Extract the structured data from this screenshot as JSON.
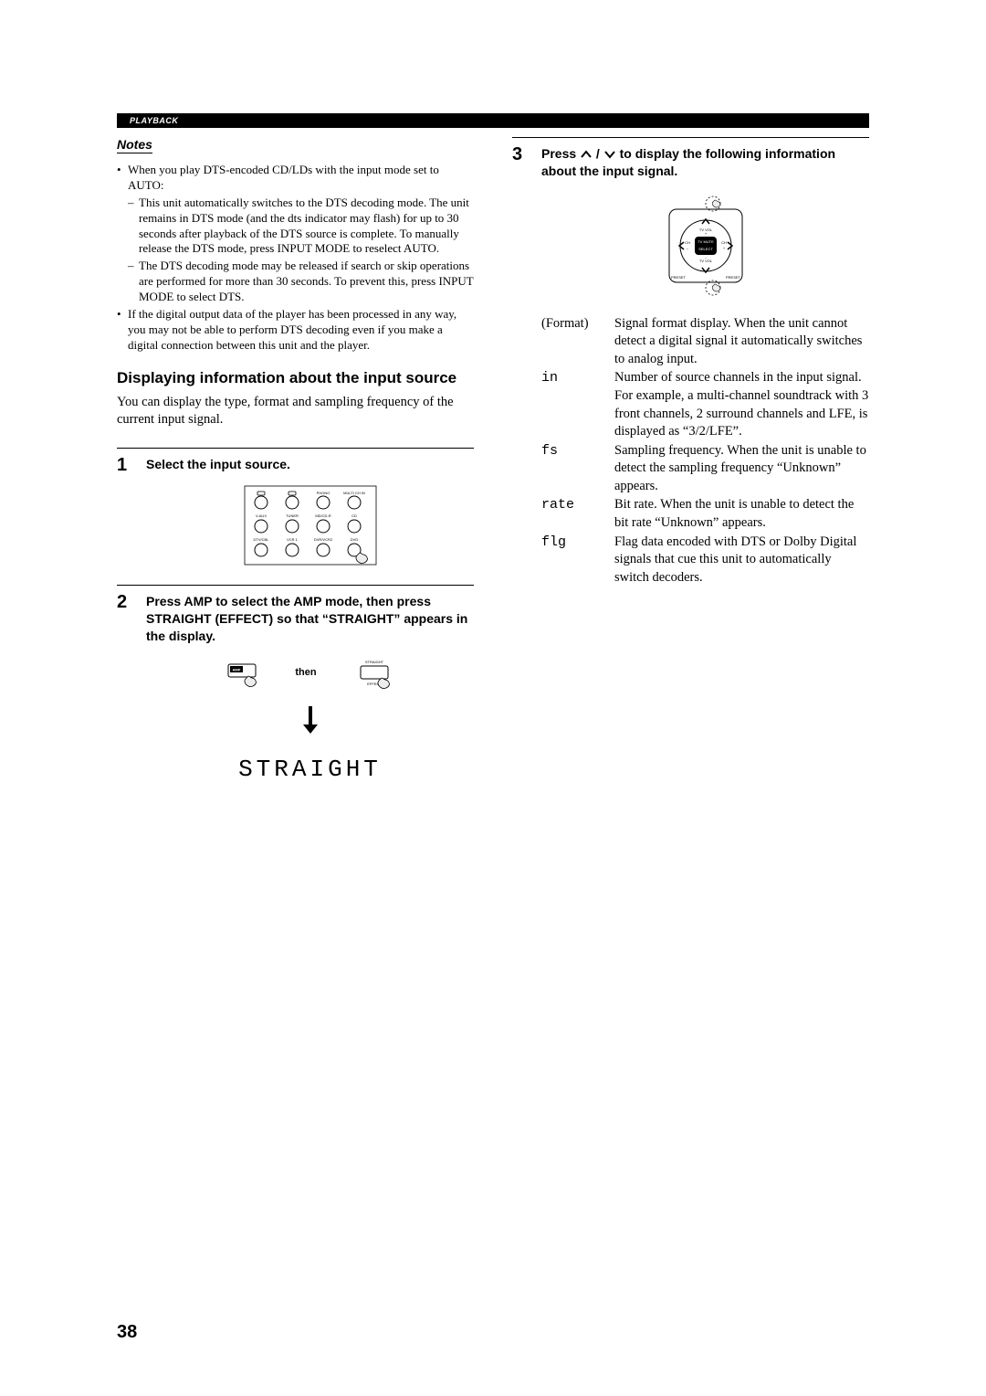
{
  "section": "PLAYBACK",
  "notesHeading": "Notes",
  "notes": {
    "item1": "When you play DTS-encoded CD/LDs with the input mode set to AUTO:",
    "sub1": "This unit automatically switches to the DTS decoding mode. The unit remains in DTS mode (and the dts indicator may flash) for up to 30 seconds after playback of the DTS source is complete. To manually release the DTS mode, press INPUT MODE to reselect AUTO.",
    "sub2": "The DTS decoding mode may be released if search or skip operations are performed for more than 30 seconds. To prevent this, press INPUT MODE to select DTS.",
    "item2": "If the digital output data of the player has been processed in any way, you may not be able to perform DTS decoding even if you make a digital connection between this unit and the player."
  },
  "heading": "Displaying information about the input source",
  "body": "You can display the type, format and sampling frequency of the current input signal.",
  "step1": {
    "num": "1",
    "text": "Select the input source.",
    "labels": {
      "r1c3": "PHONO",
      "r1c4": "MULTI CH IN",
      "r2c1": "V-AUX",
      "r2c2": "TUNER",
      "r2c3": "MD/CD-R",
      "r2c4": "CD",
      "r3c1": "DTV/CBL",
      "r3c2": "VCR 1",
      "r3c3": "DVR/VCR2",
      "r3c4": "DVD"
    }
  },
  "step2": {
    "num": "2",
    "text": "Press AMP to select the AMP mode, then press STRAIGHT (EFFECT) so that “STRAIGHT” appears in the display.",
    "labels": {
      "amp": "AMP",
      "then": "then",
      "straight": "STRAIGHT",
      "effect": "EFFECT"
    },
    "display": "STRAIGHT"
  },
  "step3": {
    "num": "3",
    "textPrefix": "Press ",
    "textSuffix": " to display the following information about the input signal.",
    "labels": {
      "tvvolplus": "TV VOL",
      "tvvolminus": "TV VOL",
      "chminus": "CH",
      "chplus": "CH",
      "minus": "–",
      "plus": "+",
      "tvmute": "TV MUTE",
      "select": "SELECT",
      "presetL": "PRESET",
      "presetR": "PRESET"
    }
  },
  "definitions": {
    "format": {
      "term": "(Format)",
      "def": "Signal format display. When the unit cannot detect a digital signal it automatically switches to analog input."
    },
    "in": {
      "term": "in",
      "def": "Number of source channels in the input signal. For example, a multi-channel soundtrack with 3 front channels, 2 surround channels and LFE, is displayed as “3/2/LFE”."
    },
    "fs": {
      "term": "fs",
      "def": "Sampling frequency. When the unit is unable to detect the sampling frequency “Unknown” appears."
    },
    "rate": {
      "term": "rate",
      "def": "Bit rate. When the unit is unable to detect the bit rate “Unknown” appears."
    },
    "flg": {
      "term": "flg",
      "def": "Flag data encoded with DTS or Dolby Digital signals that cue this unit to automatically switch decoders."
    }
  },
  "pageNum": "38"
}
